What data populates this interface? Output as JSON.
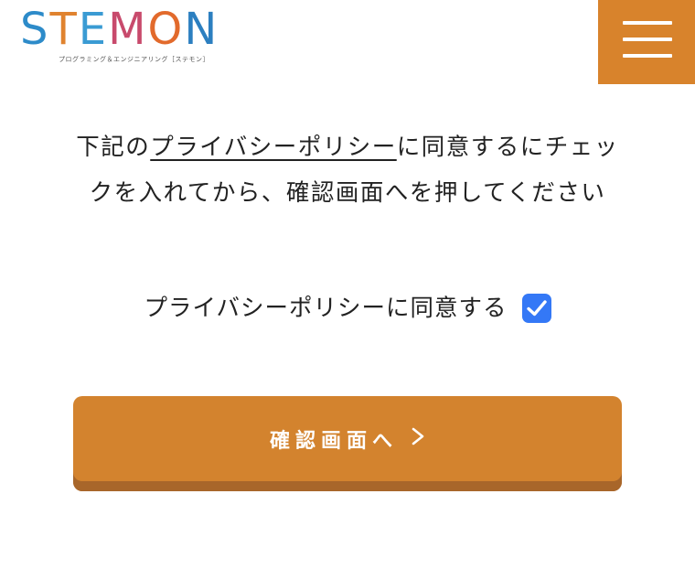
{
  "header": {
    "logo_letters": [
      "S",
      "T",
      "E",
      "M",
      "O",
      "N"
    ],
    "logo_colors": [
      "#2d8bc9",
      "#e0832f",
      "#3a9bd3",
      "#c84a6c",
      "#e26a2c",
      "#2c7fc0"
    ],
    "logo_subtitle": "プログラミング＆エンジニアリング［ステモン］",
    "menu_icon": "hamburger-menu-icon",
    "accent_color": "#d8832c"
  },
  "intro": {
    "text_before": "下記の",
    "link_text": "プライバシーポリシー",
    "text_after": "に同意するにチェックを入れてから、確認画面へを押してください"
  },
  "agree": {
    "label": "プライバシーポリシーに同意する",
    "checked": true,
    "checkbox_color": "#3478f6"
  },
  "confirm_button": {
    "label": "確認画面へ",
    "icon": "chevron-right-icon"
  }
}
